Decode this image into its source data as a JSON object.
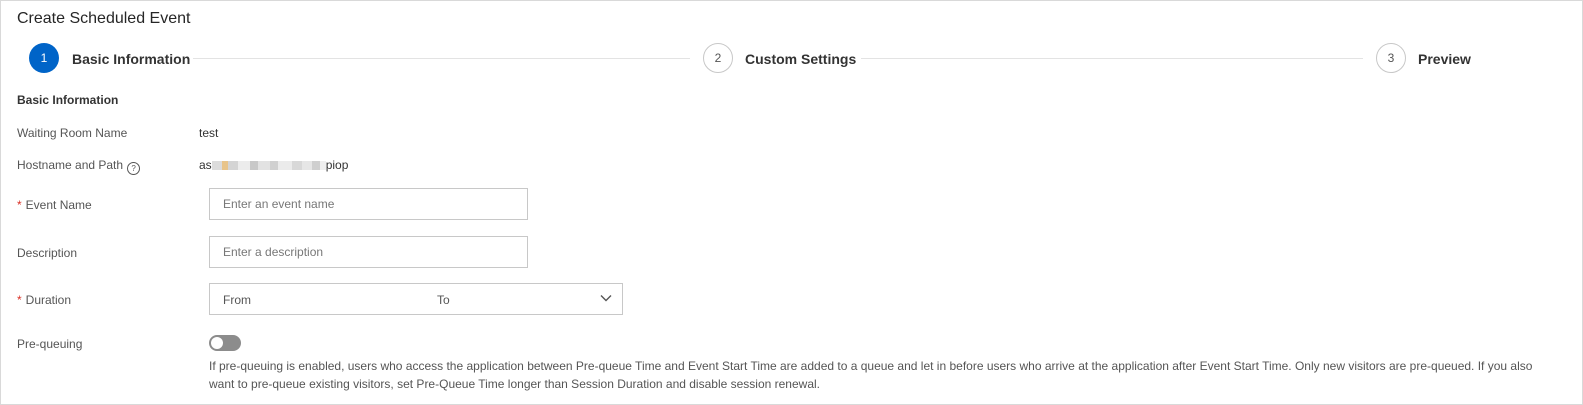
{
  "page": {
    "title": "Create Scheduled Event"
  },
  "steps": [
    {
      "number": "1",
      "label": "Basic Information",
      "state": "active"
    },
    {
      "number": "2",
      "label": "Custom Settings",
      "state": "pending"
    },
    {
      "number": "3",
      "label": "Preview",
      "state": "pending"
    }
  ],
  "section": {
    "title": "Basic Information"
  },
  "fields": {
    "waiting_room_name": {
      "label": "Waiting Room Name",
      "value": "test"
    },
    "hostname_path": {
      "label": "Hostname and Path",
      "help_icon": "question-circle-icon",
      "value_prefix": "as",
      "value_suffix": "piop"
    },
    "event_name": {
      "label": "Event Name",
      "required_mark": "*",
      "placeholder": "Enter an event name",
      "value": ""
    },
    "description": {
      "label": "Description",
      "placeholder": "Enter a description",
      "value": ""
    },
    "duration": {
      "label": "Duration",
      "required_mark": "*",
      "from": "From",
      "to": "To",
      "icon": "chevron-down-icon"
    },
    "pre_queuing": {
      "label": "Pre-queuing",
      "enabled": false,
      "hint": "If pre-queuing is enabled, users who access the application between Pre-queue Time and Event Start Time are added to a queue and let in before users who arrive at the application after Event Start Time. Only new visitors are pre-queued. If you also want to pre-queue existing visitors, set Pre-Queue Time longer than Session Duration and disable session renewal."
    }
  },
  "colors": {
    "primary": "#0064c8",
    "required": "#d93026",
    "toggle_off": "#8c8c8c"
  }
}
